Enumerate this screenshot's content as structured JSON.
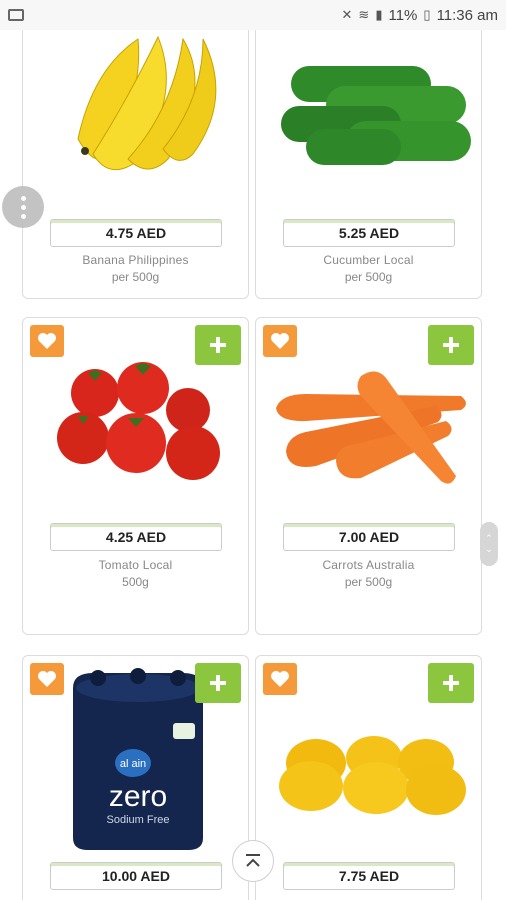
{
  "status_bar": {
    "battery": "11%",
    "time": "11:36 am"
  },
  "products": [
    {
      "price": "4.75 AED",
      "name": "Banana Philippines",
      "unit": "per 500g"
    },
    {
      "price": "5.25 AED",
      "name": "Cucumber Local",
      "unit": "per 500g"
    },
    {
      "price": "4.25 AED",
      "name": "Tomato Local",
      "unit": "500g"
    },
    {
      "price": "7.00 AED",
      "name": "Carrots Australia",
      "unit": "per 500g"
    },
    {
      "price": "10.00 AED",
      "name": "",
      "unit": ""
    },
    {
      "price": "7.75 AED",
      "name": "",
      "unit": ""
    }
  ],
  "water_bottle": {
    "brand": "al ain",
    "label": "zero",
    "sub": "Sodium Free"
  },
  "colors": {
    "favorite": "#f59a3a",
    "add": "#8bc63e"
  }
}
